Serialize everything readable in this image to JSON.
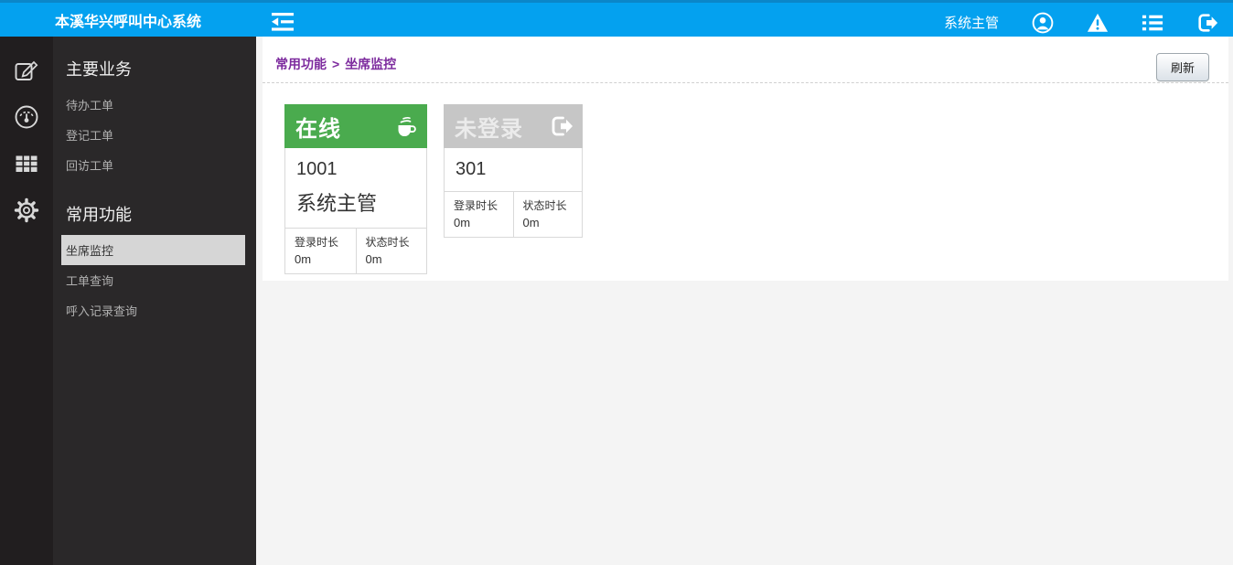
{
  "topbar": {
    "brand": "本溪华兴呼叫中心系统",
    "user": "系统主管"
  },
  "sidebar": {
    "sections": [
      {
        "heading": "主要业务",
        "items": [
          "待办工单",
          "登记工单",
          "回访工单"
        ]
      },
      {
        "heading": "常用功能",
        "items": [
          "坐席监控",
          "工单查询",
          "呼入记录查询"
        ]
      }
    ],
    "icons": [
      "edit-icon",
      "gauge-icon",
      "table-icon",
      "gear-icon"
    ]
  },
  "breadcrumb": {
    "parent": "常用功能",
    "separator": ">",
    "current": "坐席监控"
  },
  "toolbar": {
    "refresh_label": "刷新"
  },
  "cards": [
    {
      "status": "在线",
      "icon": "coffee-icon",
      "agent_id": "1001",
      "agent_name": "系统主管",
      "header_color": "#4aab4e",
      "metrics": [
        {
          "label": "登录时长",
          "value": "0m"
        },
        {
          "label": "状态时长",
          "value": "0m"
        }
      ]
    },
    {
      "status": "未登录",
      "icon": "logout-icon",
      "agent_id": "301",
      "header_color": "#c6c6c6",
      "metrics": [
        {
          "label": "登录时长",
          "value": "0m"
        },
        {
          "label": "状态时长",
          "value": "0m"
        }
      ]
    }
  ],
  "colors": {
    "topbar_blue": "#04a1ef",
    "topbar_strip": "#0b86c8",
    "sidebar_dark": "#2a2829",
    "sidebar_icon_col": "#211e1f",
    "selected_item_bg": "#d6d6d6",
    "breadcrumb_purple": "#7d2b9e",
    "online_green": "#4aab4e",
    "offline_gray": "#c6c6c6"
  }
}
